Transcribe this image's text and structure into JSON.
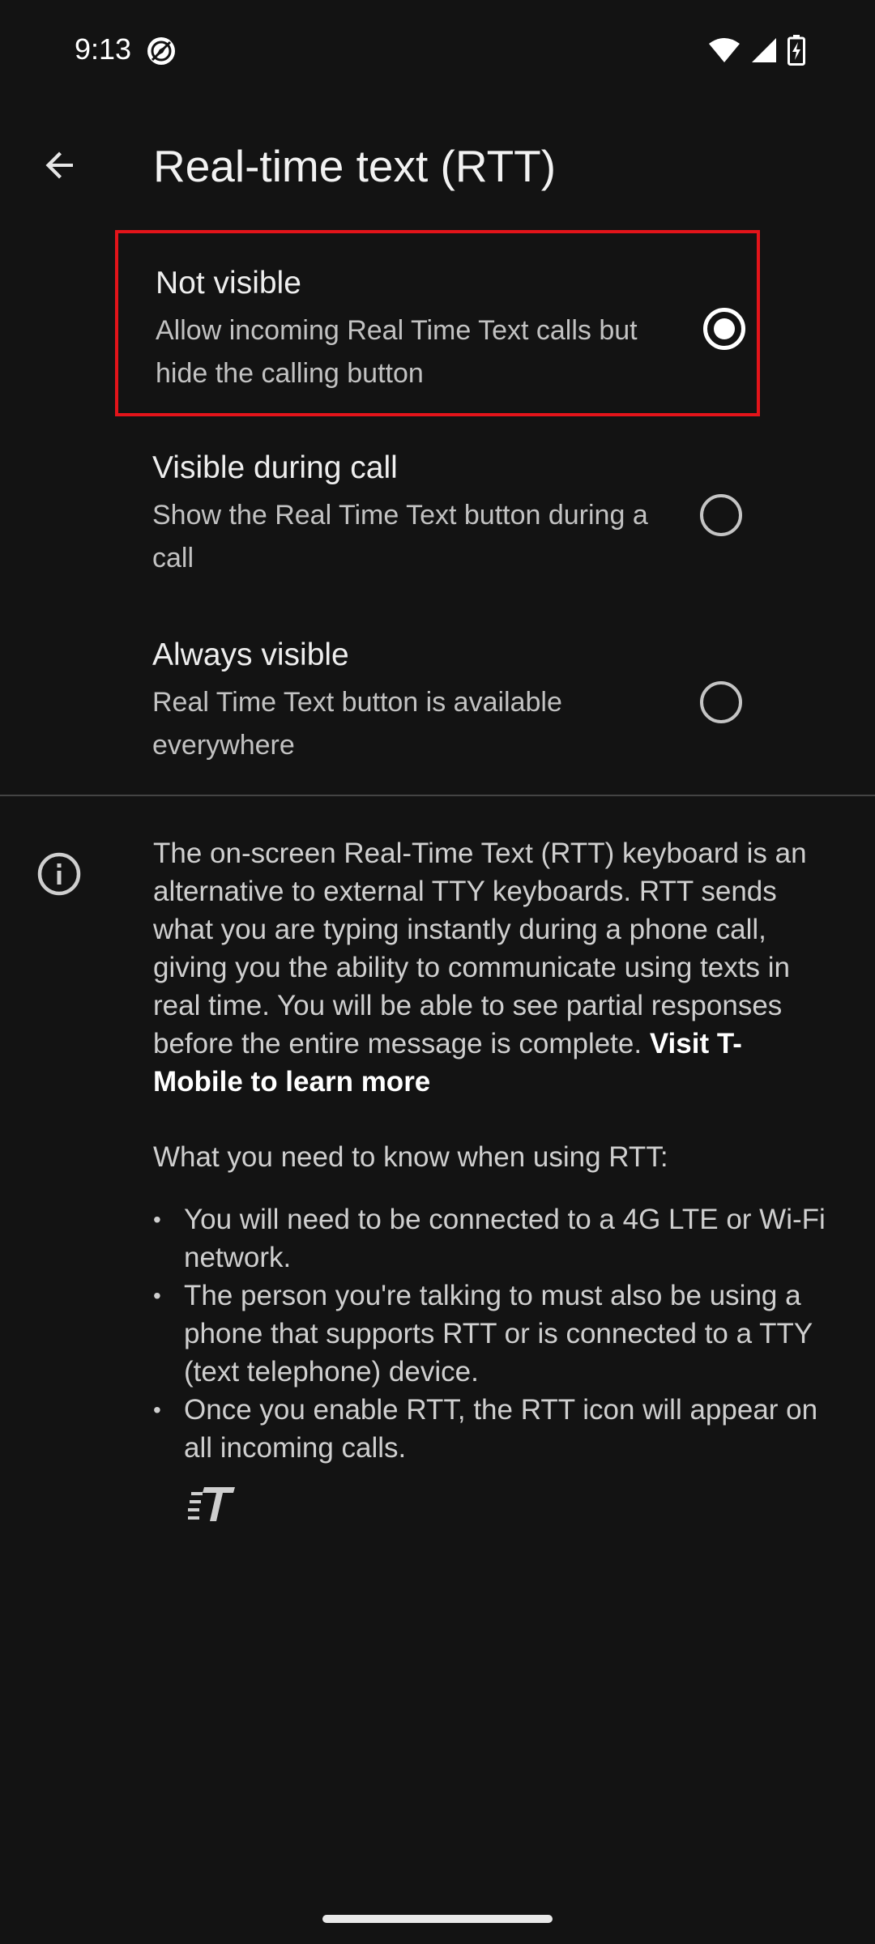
{
  "status_bar": {
    "time": "9:13"
  },
  "app_bar": {
    "title": "Real-time text (RTT)"
  },
  "options": [
    {
      "title": "Not visible",
      "summary": "Allow incoming Real Time Text calls but hide the calling button",
      "selected": true
    },
    {
      "title": "Visible during call",
      "summary": "Show the Real Time Text button during a call",
      "selected": false
    },
    {
      "title": "Always visible",
      "summary": "Real Time Text button is available everywhere",
      "selected": false
    }
  ],
  "info": {
    "paragraph": "The on-screen Real-Time Text (RTT) keyboard is an alternative to external TTY keyboards. RTT sends what you are typing instantly during a phone call, giving you the ability to communicate using texts in real time. You will be able to see partial responses before the entire message is complete.",
    "link_text": "Visit T-Mobile to learn more",
    "know_heading": "What you need to know when using RTT:",
    "bullets": [
      "You will need to be connected to a 4G LTE or Wi-Fi network.",
      "The person you're talking to must also be using a phone that supports RTT or is connected to a TTY (text telephone) device.",
      "Once you enable RTT, the RTT icon will appear on all incoming calls."
    ],
    "bullet_marker": "•"
  },
  "colors": {
    "background": "#131313",
    "highlight_outline": "#e3141a",
    "primary_text": "#eeeeee",
    "secondary_text": "#c2c2c2"
  },
  "icons": {
    "back": "arrow-back-icon",
    "info": "info-icon",
    "rtt": "rtt-icon",
    "wifi": "wifi-icon",
    "signal": "cell-signal-icon",
    "battery": "battery-charging-icon",
    "status_app": "location-compass-icon"
  }
}
